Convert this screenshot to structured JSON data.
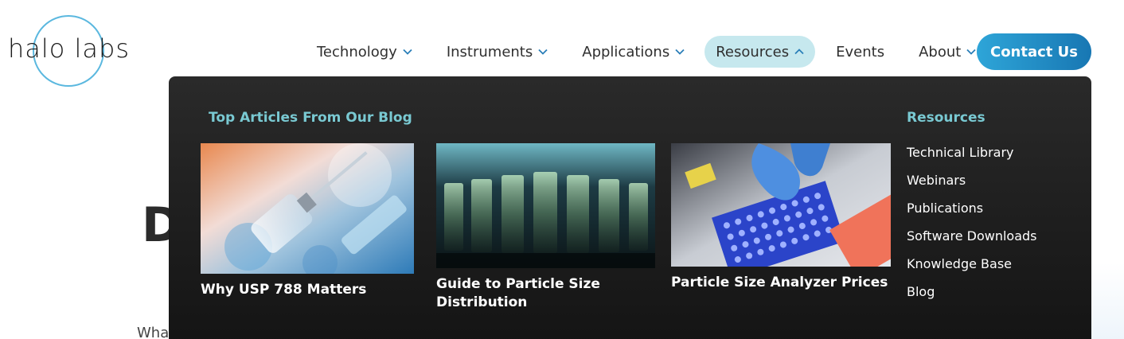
{
  "logo": {
    "text": "halo labs"
  },
  "nav": {
    "items": [
      {
        "label": "Technology",
        "has_chevron": true,
        "active": false
      },
      {
        "label": "Instruments",
        "has_chevron": true,
        "active": false
      },
      {
        "label": "Applications",
        "has_chevron": true,
        "active": false
      },
      {
        "label": "Resources",
        "has_chevron": true,
        "active": true
      },
      {
        "label": "Events",
        "has_chevron": false,
        "active": false
      },
      {
        "label": "About",
        "has_chevron": true,
        "active": false
      }
    ],
    "contact_label": "Contact Us"
  },
  "dropdown": {
    "blog_heading": "Top Articles From Our Blog",
    "articles": [
      {
        "title": "Why USP 788 Matters",
        "image": "syringe-vial-image"
      },
      {
        "title": "Guide to Particle Size Distribution",
        "image": "test-tubes-image"
      },
      {
        "title": "Particle Size Analyzer Prices",
        "image": "lab-plate-image"
      }
    ],
    "resources_heading": "Resources",
    "resources": [
      "Technical Library",
      "Webinars",
      "Publications",
      "Software Downloads",
      "Knowledge Base",
      "Blog"
    ]
  },
  "colors": {
    "accent_teal": "#79c9d2",
    "active_pill": "#c6e8ee",
    "contact_start": "#2ea5d8",
    "contact_end": "#1877b3",
    "chevron": "#2a7fb8",
    "dropdown_bg": "#1f1f1f"
  },
  "background": {
    "heading_fragment": "D",
    "para_fragment": "Wha"
  }
}
